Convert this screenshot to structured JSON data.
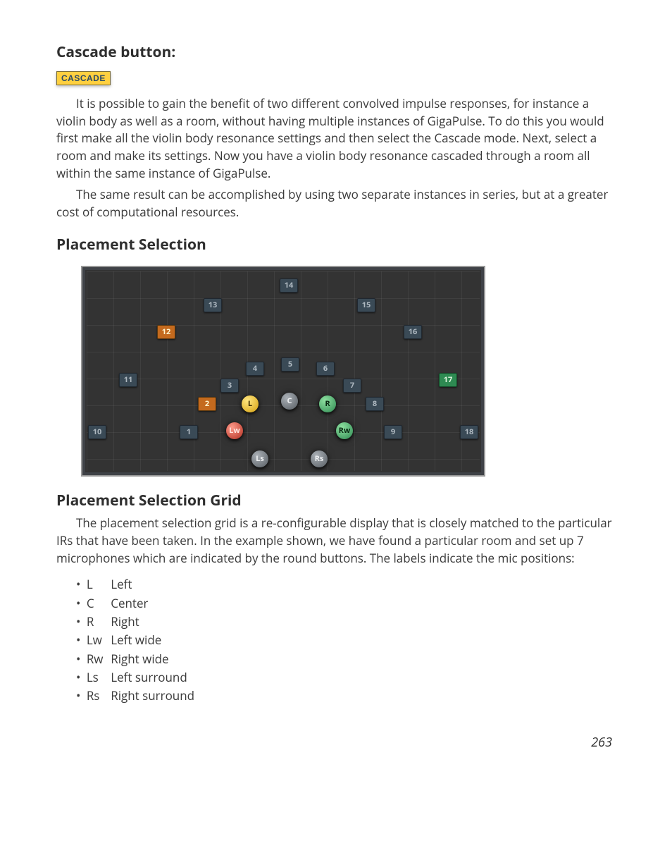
{
  "sections": {
    "cascade_heading": "Cascade button:",
    "cascade_badge": "CASCADE",
    "p1": "It is possible to gain the benefit of two different convolved impulse responses, for instance a violin body as well as a room, without having multiple instances of GigaPulse. To do this you would first make all the violin body resonance settings and then select the Cascade mode. Next, select a room and make its settings. Now you have a violin body resonance cascaded through a room all within the same instance of GigaPulse.",
    "p2": "The same result can be accomplished by using two separate instances in series, but at a greater cost of computational resources.",
    "placement_heading": "Placement Selection",
    "grid_heading": "Placement Selection Grid",
    "p3": "The placement selection grid is a re-configurable display that is closely matched to the particular IRs that have been taken. In the example shown, we have found a particular room and set up 7 microphones which are indicated by the round buttons. The labels indicate the mic positions:"
  },
  "grid": {
    "numbers": {
      "n1": "1",
      "n2": "2",
      "n3": "3",
      "n4": "4",
      "n5": "5",
      "n6": "6",
      "n7": "7",
      "n8": "8",
      "n9": "9",
      "n10": "10",
      "n11": "11",
      "n12": "12",
      "n13": "13",
      "n14": "14",
      "n15": "15",
      "n16": "16",
      "n17": "17",
      "n18": "18"
    },
    "mics": {
      "L": "L",
      "C": "C",
      "R": "R",
      "Lw": "Lw",
      "Rw": "Rw",
      "Ls": "Ls",
      "Rs": "Rs"
    }
  },
  "mic_legend": [
    {
      "code": "L",
      "label": "Left"
    },
    {
      "code": "C",
      "label": "Center"
    },
    {
      "code": "R",
      "label": "Right"
    },
    {
      "code": "Lw",
      "label": "Left wide"
    },
    {
      "code": "Rw",
      "label": "Right wide"
    },
    {
      "code": "Ls",
      "label": "Left surround"
    },
    {
      "code": "Rs",
      "label": "Right surround"
    }
  ],
  "page_number": "263"
}
